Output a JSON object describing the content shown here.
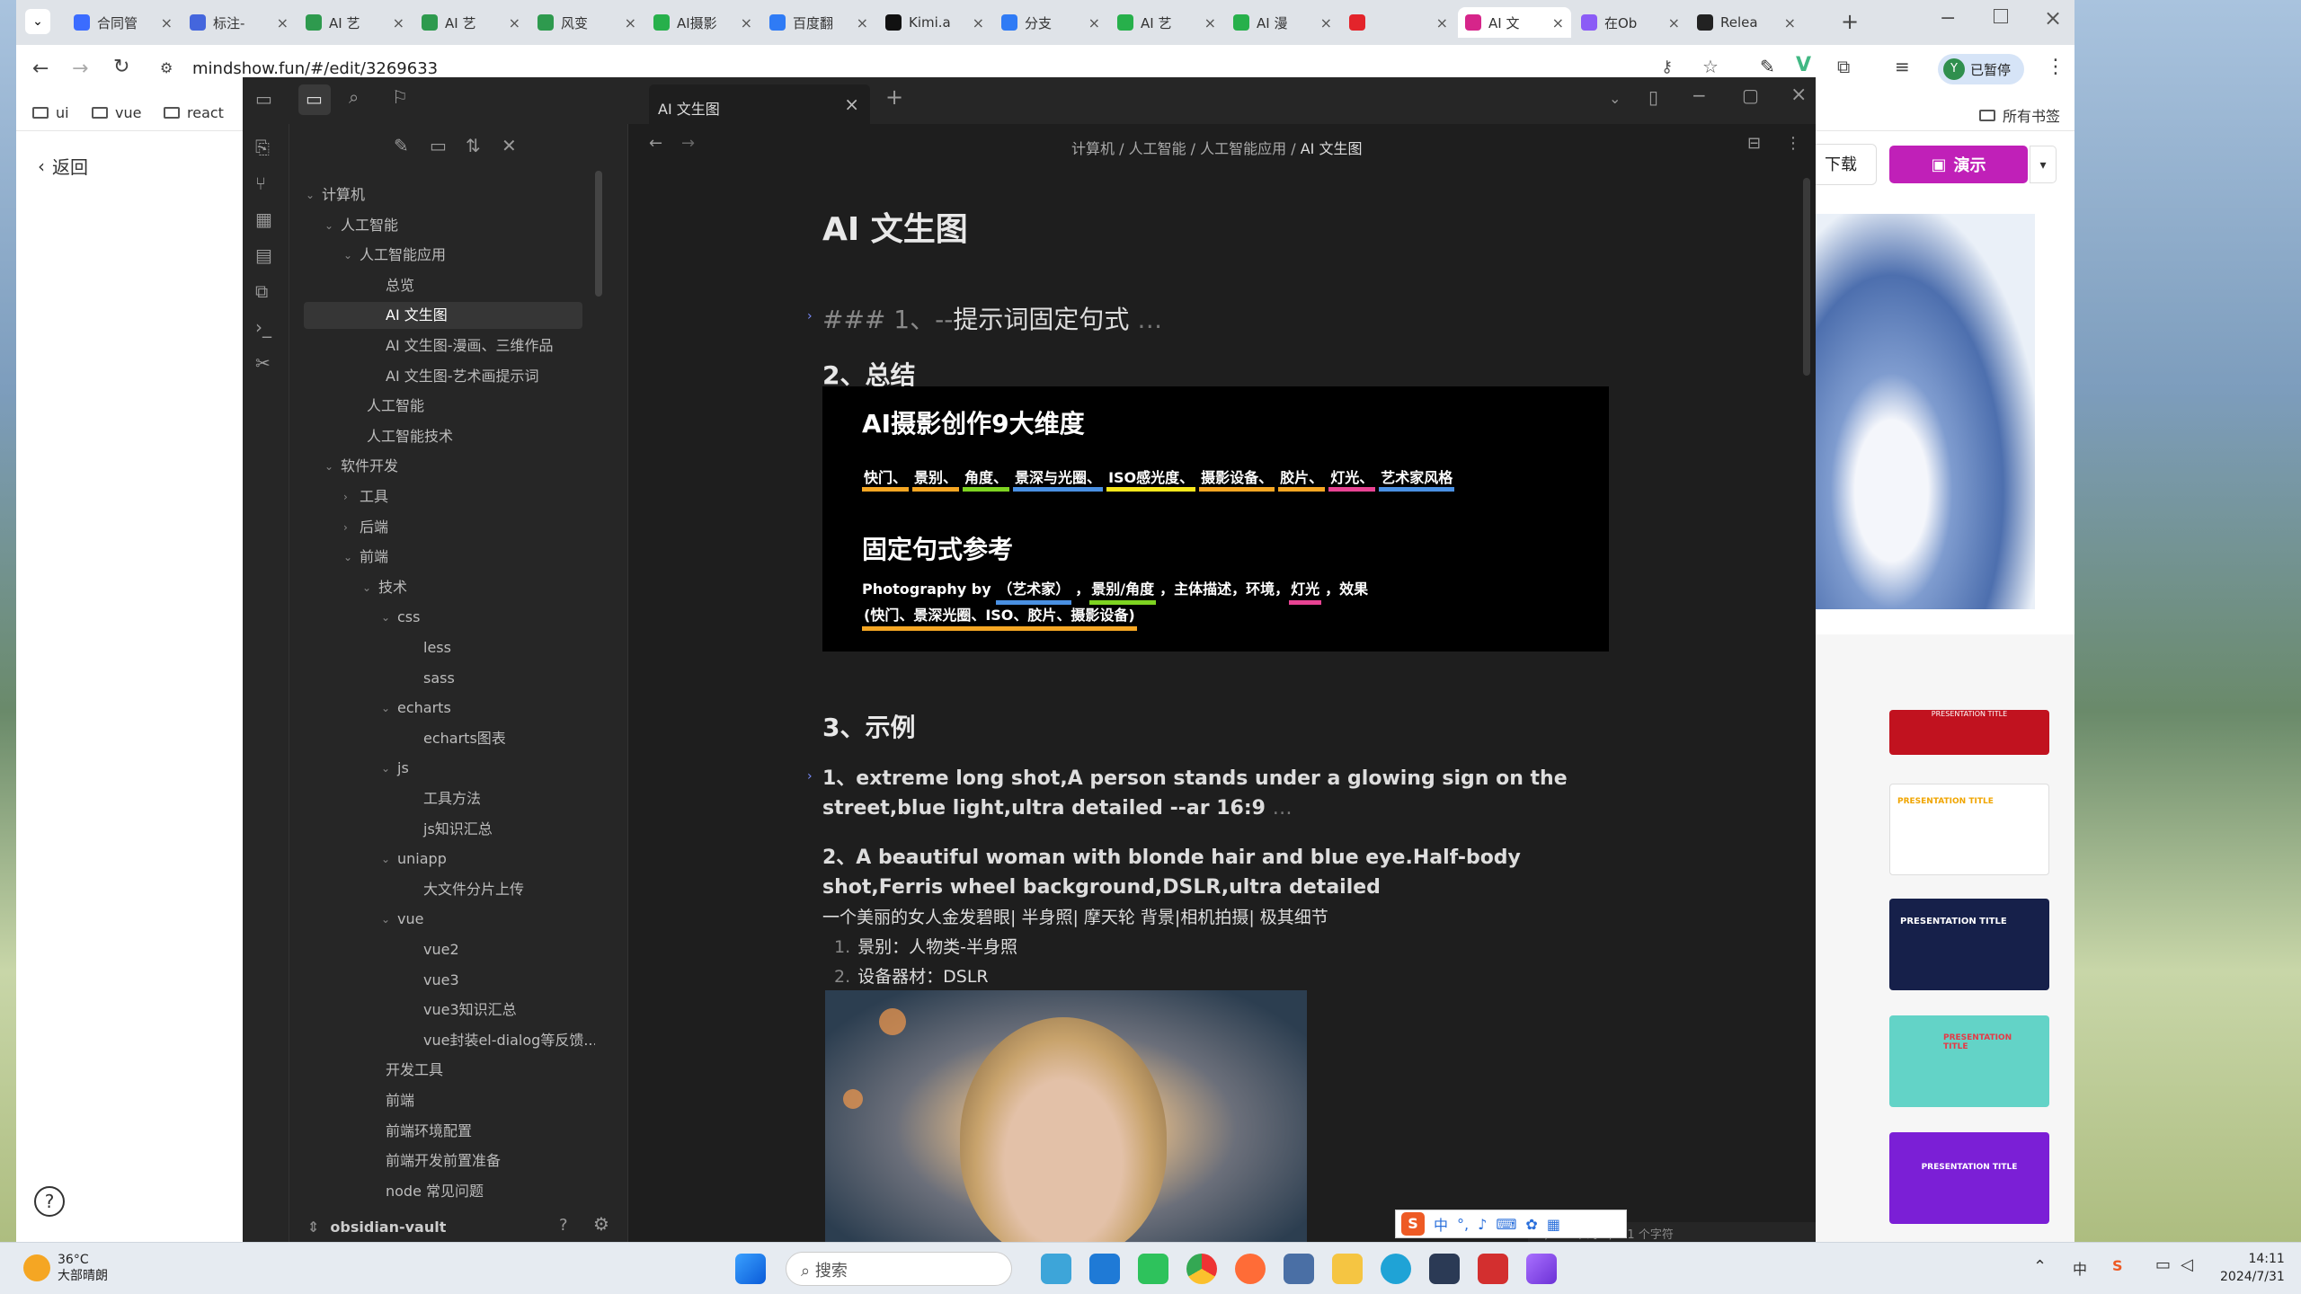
{
  "browser": {
    "tabs": [
      {
        "label": "合同管",
        "color": "#3b6cff"
      },
      {
        "label": "标注-",
        "color": "#4466dd"
      },
      {
        "label": "AI 艺",
        "color": "#2e9a4e"
      },
      {
        "label": "AI 艺",
        "color": "#2e9a4e"
      },
      {
        "label": "风变",
        "color": "#2e9a4e"
      },
      {
        "label": "AI摄影",
        "color": "#27b04b"
      },
      {
        "label": "百度翻",
        "color": "#2f7bf5"
      },
      {
        "label": "Kimi.a",
        "color": "#111111"
      },
      {
        "label": "分支",
        "color": "#2f7bf5"
      },
      {
        "label": "AI 艺",
        "color": "#27b04b"
      },
      {
        "label": "AI 漫",
        "color": "#27b04b"
      },
      {
        "label": "",
        "color": "#e3242b"
      },
      {
        "label": "AI 文",
        "color": "#d6258a"
      },
      {
        "label": "在Ob",
        "color": "#8b5cf6"
      },
      {
        "label": "Relea",
        "color": "#222222"
      }
    ],
    "url": "mindshow.fun/#/edit/3269633",
    "paused_label": "已暂停",
    "avatar_letter": "Y",
    "bookmarks": [
      "ui",
      "vue",
      "react"
    ],
    "all_bookmarks": "所有书签"
  },
  "site": {
    "back_label": "返回",
    "download_label": "下载",
    "present_label": "演示",
    "slides": [
      {
        "title": "PRESENTATION TITLE",
        "style": "red"
      },
      {
        "title": "PRESENTATION TITLE",
        "style": "white"
      },
      {
        "title": "PRESENTATION TITLE",
        "style": "navy"
      },
      {
        "title": "PRESENTATION TITLE",
        "style": "mint"
      },
      {
        "title": "PRESENTATION TITLE",
        "style": "purple"
      }
    ]
  },
  "obsidian": {
    "tab_title": "AI 文生图",
    "breadcrumb": [
      "计算机",
      "人工智能",
      "人工智能应用",
      "AI 文生图"
    ],
    "vault_name": "obsidian-vault",
    "tree": [
      {
        "label": "计算机",
        "depth": 0,
        "chev": "v"
      },
      {
        "label": "人工智能",
        "depth": 1,
        "chev": "v"
      },
      {
        "label": "人工智能应用",
        "depth": 2,
        "chev": "v"
      },
      {
        "label": "总览",
        "depth": 3,
        "chev": ""
      },
      {
        "label": "AI 文生图",
        "depth": 3,
        "chev": "",
        "active": true
      },
      {
        "label": "AI 文生图-漫画、三维作品",
        "depth": 3,
        "chev": ""
      },
      {
        "label": "AI 文生图-艺术画提示词",
        "depth": 3,
        "chev": ""
      },
      {
        "label": "人工智能",
        "depth": 2,
        "chev": ""
      },
      {
        "label": "人工智能技术",
        "depth": 2,
        "chev": ""
      },
      {
        "label": "软件开发",
        "depth": 1,
        "chev": "v"
      },
      {
        "label": "工具",
        "depth": 2,
        "chev": ">"
      },
      {
        "label": "后端",
        "depth": 2,
        "chev": ">"
      },
      {
        "label": "前端",
        "depth": 2,
        "chev": "v"
      },
      {
        "label": "技术",
        "depth": 3,
        "chev": "v"
      },
      {
        "label": "css",
        "depth": 4,
        "chev": "v"
      },
      {
        "label": "less",
        "depth": 5,
        "chev": ""
      },
      {
        "label": "sass",
        "depth": 5,
        "chev": ""
      },
      {
        "label": "echarts",
        "depth": 4,
        "chev": "v"
      },
      {
        "label": "echarts图表",
        "depth": 5,
        "chev": ""
      },
      {
        "label": "js",
        "depth": 4,
        "chev": "v"
      },
      {
        "label": "工具方法",
        "depth": 5,
        "chev": ""
      },
      {
        "label": "js知识汇总",
        "depth": 5,
        "chev": ""
      },
      {
        "label": "uniapp",
        "depth": 4,
        "chev": "v"
      },
      {
        "label": "大文件分片上传",
        "depth": 5,
        "chev": ""
      },
      {
        "label": "vue",
        "depth": 4,
        "chev": "v"
      },
      {
        "label": "vue2",
        "depth": 5,
        "chev": ""
      },
      {
        "label": "vue3",
        "depth": 5,
        "chev": ""
      },
      {
        "label": "vue3知识汇总",
        "depth": 5,
        "chev": ""
      },
      {
        "label": "vue封装el-dialog等反馈...",
        "depth": 5,
        "chev": ""
      },
      {
        "label": "开发工具",
        "depth": 3,
        "chev": ""
      },
      {
        "label": "前端",
        "depth": 3,
        "chev": ""
      },
      {
        "label": "前端环境配置",
        "depth": 3,
        "chev": ""
      },
      {
        "label": "前端开发前置准备",
        "depth": 3,
        "chev": ""
      },
      {
        "label": "node 常见问题",
        "depth": 3,
        "chev": ""
      }
    ],
    "doc": {
      "title": "AI 文生图",
      "h1_prefix": "### 1、--",
      "h1_text": "提示词固定句式",
      "h2": "2、总结",
      "info_title": "AI摄影创作9大维度",
      "info_dims": [
        {
          "t": "快门、",
          "c": "#f5a623"
        },
        {
          "t": "景别、",
          "c": "#f5a623"
        },
        {
          "t": "角度、",
          "c": "#7ed321"
        },
        {
          "t": "景深与光圈、",
          "c": "#4a90e2"
        },
        {
          "t": "ISO感光度、",
          "c": "#f8e71c"
        },
        {
          "t": "摄影设备、",
          "c": "#f5a623"
        },
        {
          "t": "胶片、",
          "c": "#f5a623"
        },
        {
          "t": "灯光、",
          "c": "#e84393"
        },
        {
          "t": "艺术家风格",
          "c": "#4a90e2"
        }
      ],
      "info_sub": "固定句式参考",
      "info_formula_a": "Photography by ",
      "info_formula_artist": "（艺术家）",
      "info_formula_b": "，",
      "info_formula_shot": "景别/角度",
      "info_formula_c": "，主体描述，环境，",
      "info_formula_light": "灯光",
      "info_formula_d": "，效果 ",
      "info_formula_effect": "(快门、景深光圈、ISO、胶片、摄影设备)",
      "h3": "3、示例",
      "ex1": "1、extreme long shot,A person stands under a glowing sign on the street,blue light,ultra detailed --ar 16:9",
      "ex2": "2、A beautiful woman with blonde hair and blue eye.Half-body shot,Ferris wheel background,DSLR,ultra detailed",
      "ex2_cn": "一个美丽的女人金发碧眼| 半身照| 摩天轮 背景|相机拍摄| 极其细节",
      "list": [
        "景别：人物类-半身照",
        "设备器材：DSLR"
      ],
      "status": "1,719 个词  7,601 个字符"
    }
  },
  "taskbar": {
    "temp": "36°C",
    "weather": "大部晴朗",
    "search_placeholder": "搜索",
    "time": "14:11",
    "date": "2024/7/31",
    "ime": [
      "中",
      "°,"
    ]
  }
}
